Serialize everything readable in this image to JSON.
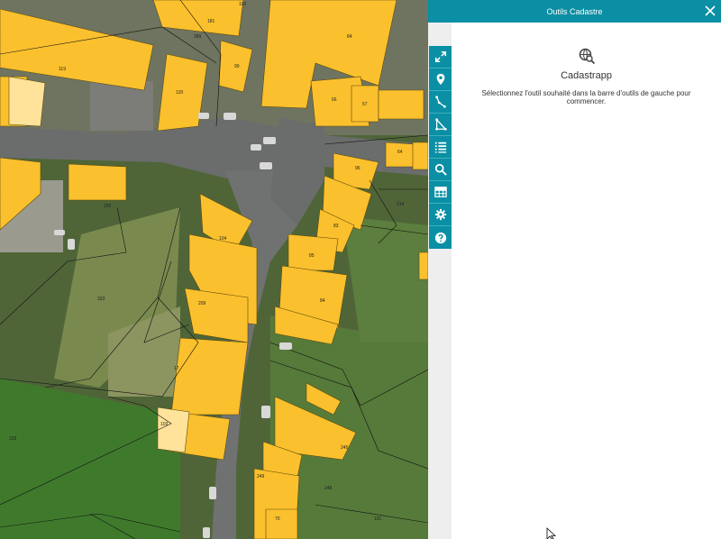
{
  "panel": {
    "title": "Outils Cadastre",
    "app_name": "Cadastrapp",
    "description": "Sélectionnez l'outil souhaité dans la barre d'outils de gauche pour commencer."
  },
  "toolbar": {
    "items": [
      {
        "icon": "expand-icon"
      },
      {
        "icon": "map-marker-icon"
      },
      {
        "icon": "line-selection-icon"
      },
      {
        "icon": "polygon-selection-icon"
      },
      {
        "icon": "list-icon"
      },
      {
        "icon": "search-icon"
      },
      {
        "icon": "table-icon"
      },
      {
        "icon": "gear-icon"
      },
      {
        "icon": "help-icon"
      }
    ]
  },
  "map": {
    "parcel_labels": [
      "102",
      "181",
      "289",
      "119",
      "99",
      "84",
      "120",
      "66",
      "57",
      "96",
      "64",
      "214",
      "250",
      "83",
      "85",
      "84",
      "104",
      "209",
      "17",
      "333",
      "245",
      "249",
      "249",
      "70",
      "103",
      "103",
      "101"
    ]
  },
  "colors": {
    "accent": "#0a8fa4",
    "building": "#fbc02d",
    "panel_bg": "#ffffff"
  }
}
